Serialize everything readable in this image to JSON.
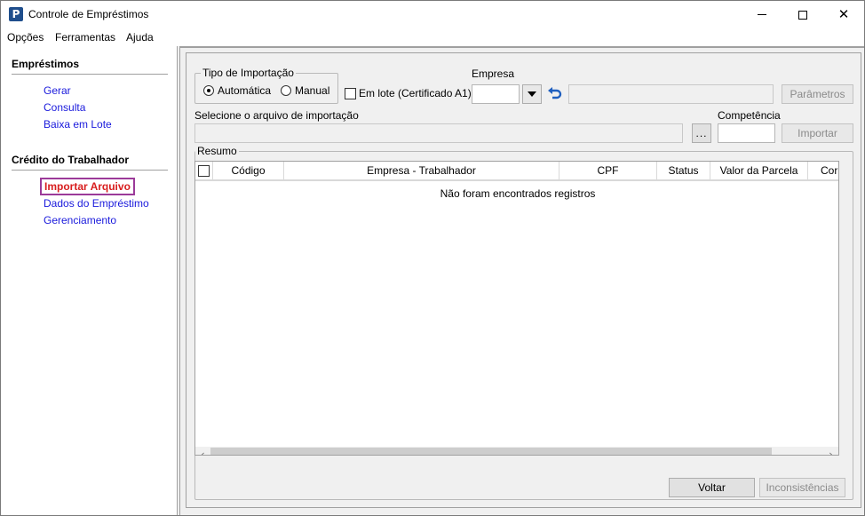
{
  "window": {
    "title": "Controle de Empréstimos",
    "icon_letter": "P",
    "close_glyph": "✕"
  },
  "menu": {
    "items": [
      "Opções",
      "Ferramentas",
      "Ajuda"
    ]
  },
  "sidebar": {
    "sections": [
      {
        "title": "Empréstimos",
        "items": [
          "Gerar",
          "Consulta",
          "Baixa em Lote"
        ]
      },
      {
        "title": "Crédito do Trabalhador",
        "items": [
          "Importar Arquivo",
          "Dados do Empréstimo",
          "Gerenciamento"
        ]
      }
    ],
    "active_item": "Importar Arquivo"
  },
  "form": {
    "tipo_importacao": {
      "legend": "Tipo de Importação",
      "options": [
        "Automática",
        "Manual"
      ],
      "selected": "Automática"
    },
    "em_lote_label": "Em lote (Certificado A1)",
    "empresa_label": "Empresa",
    "parametros_button": "Parâmetros",
    "arquivo_label": "Selecione o arquivo de importação",
    "browse_button": "...",
    "competencia_label": "Competência",
    "importar_button": "Importar"
  },
  "resumo": {
    "legend": "Resumo",
    "columns": [
      "Código",
      "Empresa - Trabalhador",
      "CPF",
      "Status",
      "Valor da Parcela",
      "Cor"
    ],
    "empty_message": "Não foram encontrados registros"
  },
  "footer": {
    "voltar_button": "Voltar",
    "inconsistencias_button": "Inconsistências"
  },
  "colors": {
    "link": "#1a1adc",
    "active_link": "#d81e1e",
    "active_border": "#9b3a99"
  },
  "icons": {
    "refresh": "refresh-icon",
    "dropdown": "chevron-down-icon",
    "scroll_left": "‹",
    "scroll_right": "›"
  }
}
